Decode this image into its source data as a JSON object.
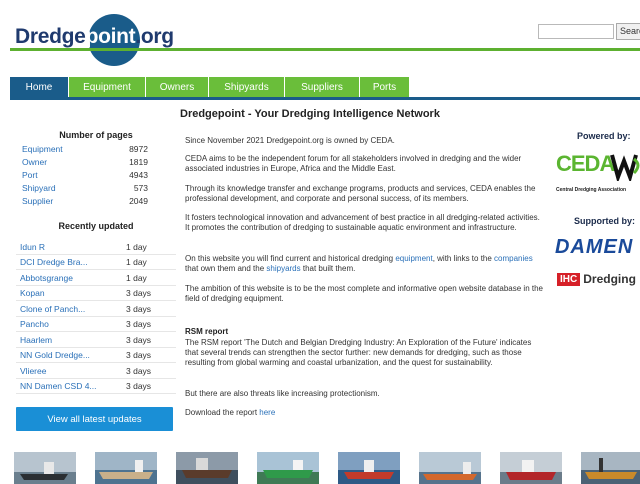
{
  "header": {
    "logo_part1": "Dredge",
    "logo_part2": "point",
    "logo_part3": ".org",
    "search_button": "Search"
  },
  "nav": {
    "items": [
      {
        "label": "Home"
      },
      {
        "label": "Equipment"
      },
      {
        "label": "Owners"
      },
      {
        "label": "Shipyards"
      },
      {
        "label": "Suppliers"
      },
      {
        "label": "Ports"
      }
    ]
  },
  "main": {
    "heading": "Dredgepoint - Your Dredging Intelligence Network",
    "p1": "Since November 2021 Dredgepoint.org is owned by CEDA.",
    "p2": "CEDA aims to be the independent forum for all stakeholders involved in dredging and the wider associated industries in Europe, Africa and the Middle East.",
    "p3": "Through its knowledge transfer and exchange programs, products and services, CEDA enables the professional development, and corporate and personal success, of its members.",
    "p4": "It fosters technological innovation and advancement of best practice in all dredging-related activities. It promotes the contribution of dredging to sustainable aquatic environment and infrastructure.",
    "p5_pre": "On this website you will find current and historical dredging ",
    "p5_link1": "equipment",
    "p5_mid1": ", with links to the ",
    "p5_link2": "companies",
    "p5_mid2": " that own them and the ",
    "p5_link3": "shipyards",
    "p5_post": " that built them.",
    "p6": "The ambition of this website is to be the most complete and informative open website database in the field of dredging equipment.",
    "rsm_title": "RSM report",
    "p7": "The RSM report 'The Dutch and Belgian Dredging Industry: An Exploration of the Future' indicates that several trends can strengthen the sector further: new demands for dredging, such as those resulting from global warming and coastal urbanization, and the quest for sustainability.",
    "p8": "But there are also threats like increasing protectionism.",
    "p9_pre": "Download the report ",
    "p9_link": "here"
  },
  "sidebar": {
    "pages_heading": "Number of pages",
    "stats": [
      {
        "label": "Equipment",
        "value": "8972"
      },
      {
        "label": "Owner",
        "value": "1819"
      },
      {
        "label": "Port",
        "value": "4943"
      },
      {
        "label": "Shipyard",
        "value": "573"
      },
      {
        "label": "Supplier",
        "value": "2049"
      }
    ],
    "updated_heading": "Recently updated",
    "updates": [
      {
        "name": "Idun R",
        "age": "1 day"
      },
      {
        "name": "DCI Dredge Bra...",
        "age": "1 day"
      },
      {
        "name": "Abbotsgrange",
        "age": "1 day"
      },
      {
        "name": "Kopan",
        "age": "3 days"
      },
      {
        "name": "Clone of Panch...",
        "age": "3 days"
      },
      {
        "name": "Pancho",
        "age": "3 days"
      },
      {
        "name": "Haarlem",
        "age": "3 days"
      },
      {
        "name": "NN Gold Dredge...",
        "age": "3 days"
      },
      {
        "name": "Vlieree",
        "age": "3 days"
      },
      {
        "name": "NN Damen CSD 4...",
        "age": "3 days"
      }
    ],
    "latest_button": "View all latest updates"
  },
  "right": {
    "powered_by": "Powered by:",
    "ceda_name": "CEDA",
    "ceda_sub": "Central Dredging Association",
    "supported_by": "Supported by:",
    "damen": "DAMEN",
    "ihc_box": "IHC",
    "ihc_text": "Dredging"
  },
  "colors": {
    "green": "#6abe3a",
    "navy": "#1a5c8a",
    "link": "#2a70b8",
    "button": "#1a8fd6"
  }
}
